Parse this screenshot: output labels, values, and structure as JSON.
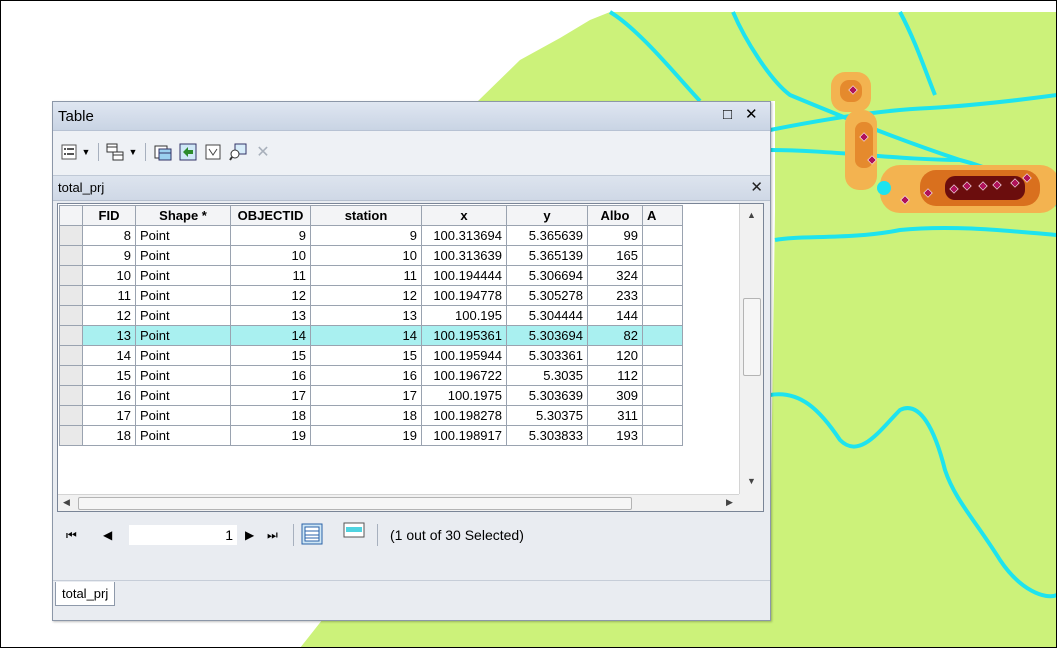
{
  "window": {
    "title": "Table",
    "maximize_icon": "□",
    "close_icon": "✕"
  },
  "toolbar": {
    "icons": [
      "table-options-icon",
      "related-tables-icon",
      "select-by-attributes-icon",
      "switch-selection-icon",
      "clear-selection-icon",
      "zoom-to-selected-icon",
      "delete-selected-icon"
    ]
  },
  "tab": {
    "name": "total_prj"
  },
  "table": {
    "columns": [
      "FID",
      "Shape *",
      "OBJECTID",
      "station",
      "x",
      "y",
      "Albo",
      "A"
    ],
    "rows": [
      [
        "8",
        "Point",
        "9",
        "9",
        "100.313694",
        "5.365639",
        "99"
      ],
      [
        "9",
        "Point",
        "10",
        "10",
        "100.313639",
        "5.365139",
        "165"
      ],
      [
        "10",
        "Point",
        "11",
        "11",
        "100.194444",
        "5.306694",
        "324"
      ],
      [
        "11",
        "Point",
        "12",
        "12",
        "100.194778",
        "5.305278",
        "233"
      ],
      [
        "12",
        "Point",
        "13",
        "13",
        "100.195",
        "5.304444",
        "144"
      ],
      [
        "13",
        "Point",
        "14",
        "14",
        "100.195361",
        "5.303694",
        "82"
      ],
      [
        "14",
        "Point",
        "15",
        "15",
        "100.195944",
        "5.303361",
        "120"
      ],
      [
        "15",
        "Point",
        "16",
        "16",
        "100.196722",
        "5.3035",
        "112"
      ],
      [
        "16",
        "Point",
        "17",
        "17",
        "100.1975",
        "5.303639",
        "309"
      ],
      [
        "17",
        "Point",
        "18",
        "18",
        "100.198278",
        "5.30375",
        "311"
      ],
      [
        "18",
        "Point",
        "19",
        "19",
        "100.198917",
        "5.303833",
        "193"
      ]
    ],
    "selected_row_index": 5
  },
  "navigation": {
    "current_record": "1",
    "status": "(1 out of 30 Selected)"
  },
  "bottom_tab": {
    "label": "total_prj"
  },
  "colors": {
    "land": "#ccf27a",
    "river": "#1ee3ee",
    "selected_row": "#a9f0f0",
    "hotspot_outer": "#f3b350",
    "hotspot_mid": "#d9701e",
    "hotspot_core": "#6b0d0d",
    "point": "#b0125a"
  }
}
